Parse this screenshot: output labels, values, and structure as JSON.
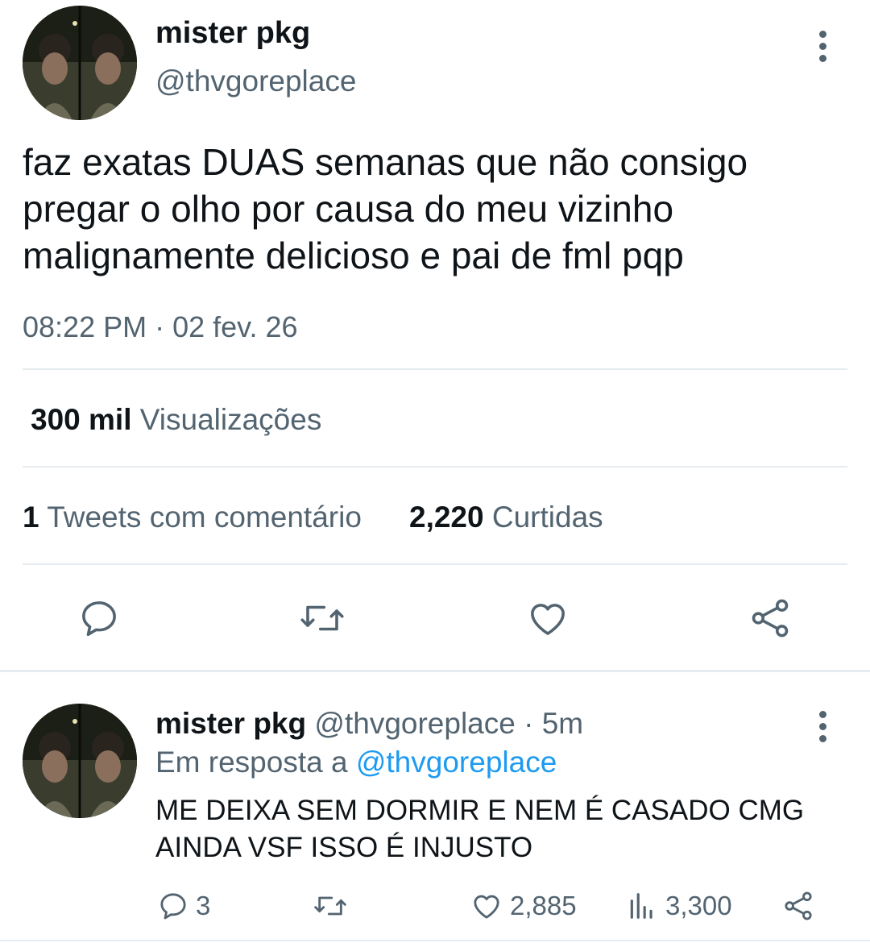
{
  "tweet": {
    "author_name": "mister pkg",
    "author_handle": "@thvgoreplace",
    "text_lines": [
      "faz exatas DUAS semanas que não consigo",
      "pregar o olho por causa do meu vizinho",
      "malignamente delicioso e pai de fml pqp"
    ],
    "timestamp": "08:22 PM · 02 fev. 26",
    "views_count": "300 mil",
    "views_label": "Visualizações",
    "quotes_count": "1",
    "quotes_label": "Tweets com comentário",
    "likes_count": "2,220",
    "likes_label": "Curtidas",
    "actions": [
      "reply-icon",
      "retweet-icon",
      "like-icon",
      "share-icon"
    ]
  },
  "reply": {
    "author_name": "mister pkg",
    "author_handle": "@thvgoreplace",
    "time": "· 5m",
    "in_reply_prefix": "Em resposta a",
    "in_reply_handle": "@thvgoreplace",
    "text_lines": [
      "ME DEIXA SEM DORMIR E NEM É CASADO CMG",
      "AINDA VSF ISSO É INJUSTO"
    ],
    "reply_count": "3",
    "like_count": "2,885",
    "views_count": "3,300"
  },
  "colors": {
    "text": "#0f1419",
    "secondary": "#536471",
    "link": "#1d9bf0",
    "divider": "#e6ecf0"
  }
}
